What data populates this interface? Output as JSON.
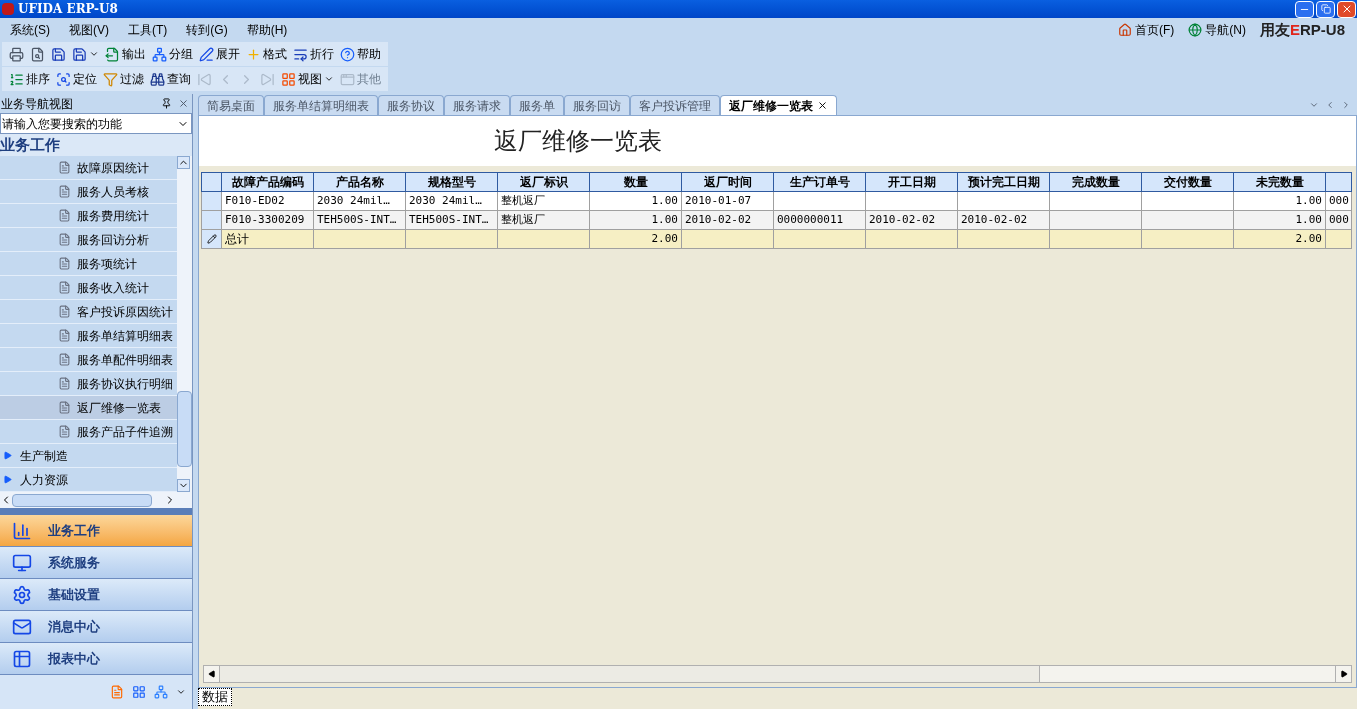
{
  "window": {
    "title": "UFIDA ERP-U8"
  },
  "menu": [
    "系统(S)",
    "视图(V)",
    "工具(T)",
    "转到(G)",
    "帮助(H)"
  ],
  "top_links": [
    {
      "label": "首页(F)",
      "kind": "home"
    },
    {
      "label": "导航(N)",
      "kind": "globe"
    }
  ],
  "logo": [
    {
      "text": "用友",
      "color": "#222222"
    },
    {
      "text": "E",
      "color": "#e0261c"
    },
    {
      "text": "RP-",
      "color": "#222222"
    },
    {
      "text": "U8",
      "color": "#222222"
    }
  ],
  "toolbar_1": [
    {
      "kind": "print",
      "disabled": false
    },
    {
      "kind": "preview",
      "disabled": false
    },
    {
      "kind": "save",
      "disabled": false
    },
    {
      "kind": "saveas",
      "disabled": false
    },
    {
      "kind": "export",
      "label": "输出",
      "disabled": false
    },
    {
      "kind": "group",
      "label": "分组",
      "disabled": false
    },
    {
      "kind": "expand",
      "label": "展开",
      "disabled": false
    },
    {
      "kind": "format",
      "label": "格式",
      "disabled": false
    },
    {
      "kind": "wrap",
      "label": "折行",
      "disabled": false
    },
    {
      "kind": "help",
      "label": "帮助",
      "disabled": false
    }
  ],
  "toolbar_2": [
    {
      "kind": "sort",
      "label": "排序",
      "disabled": false
    },
    {
      "kind": "locate",
      "label": "定位",
      "disabled": false
    },
    {
      "kind": "filter",
      "label": "过滤",
      "disabled": false
    },
    {
      "kind": "query",
      "label": "查询",
      "disabled": false
    },
    {
      "kind": "first",
      "disabled": true
    },
    {
      "kind": "prev",
      "disabled": true
    },
    {
      "kind": "next",
      "disabled": true
    },
    {
      "kind": "last",
      "disabled": true
    },
    {
      "kind": "view",
      "label": "视图",
      "disabled": false
    },
    {
      "kind": "other",
      "label": "其他",
      "disabled": true
    }
  ],
  "nav": {
    "title": "业务导航视图",
    "search_placeholder": "请输入您要搜索的功能",
    "section": "业务工作",
    "items": [
      {
        "label": "故障原因统计",
        "selected": false
      },
      {
        "label": "服务人员考核",
        "selected": false
      },
      {
        "label": "服务费用统计",
        "selected": false
      },
      {
        "label": "服务回访分析",
        "selected": false
      },
      {
        "label": "服务项统计",
        "selected": false
      },
      {
        "label": "服务收入统计",
        "selected": false
      },
      {
        "label": "客户投诉原因统计",
        "selected": false
      },
      {
        "label": "服务单结算明细表",
        "selected": false
      },
      {
        "label": "服务单配件明细表",
        "selected": false
      },
      {
        "label": "服务协议执行明细",
        "selected": false
      },
      {
        "label": "返厂维修一览表",
        "selected": true
      },
      {
        "label": "服务产品子件追溯",
        "selected": false
      }
    ],
    "groups": [
      {
        "label": "生产制造",
        "expanded": false
      },
      {
        "label": "人力资源",
        "expanded": false
      }
    ]
  },
  "modules": [
    {
      "label": "业务工作",
      "kind": "chart",
      "selected": true
    },
    {
      "label": "系统服务",
      "kind": "monitor",
      "selected": false
    },
    {
      "label": "基础设置",
      "kind": "settings",
      "selected": false
    },
    {
      "label": "消息中心",
      "kind": "mail",
      "selected": false
    },
    {
      "label": "报表中心",
      "kind": "report",
      "selected": false
    }
  ],
  "tabs": [
    {
      "label": "简易桌面",
      "selected": false
    },
    {
      "label": "服务单结算明细表",
      "selected": false
    },
    {
      "label": "服务协议",
      "selected": false
    },
    {
      "label": "服务请求",
      "selected": false
    },
    {
      "label": "服务单",
      "selected": false
    },
    {
      "label": "服务回访",
      "selected": false
    },
    {
      "label": "客户投诉管理",
      "selected": false
    },
    {
      "label": "返厂维修一览表",
      "selected": true
    }
  ],
  "report": {
    "title": "返厂维修一览表",
    "columns": [
      "故障产品编码",
      "产品名称",
      "规格型号",
      "返厂标识",
      "数量",
      "返厂时间",
      "生产订单号",
      "开工日期",
      "预计完工日期",
      "完成数量",
      "交付数量",
      "未完数量"
    ],
    "rows": [
      [
        "F010-ED02",
        "2030 24mil…",
        "2030 24mil…",
        "整机返厂",
        "1.00",
        "2010-01-07",
        "",
        "",
        "",
        "",
        "",
        "1.00",
        "000"
      ],
      [
        "F010-3300209",
        "TEH500S-INT…",
        "TEH500S-INT…",
        "整机返厂",
        "1.00",
        "2010-02-02",
        "0000000011",
        "2010-02-02",
        "2010-02-02",
        "",
        "",
        "1.00",
        "000"
      ]
    ],
    "total": {
      "label": "总计",
      "cells": [
        "",
        "",
        "",
        "2.00",
        "",
        "",
        "",
        "",
        "",
        "",
        "2.00",
        ""
      ]
    }
  },
  "status_tab": "数据"
}
